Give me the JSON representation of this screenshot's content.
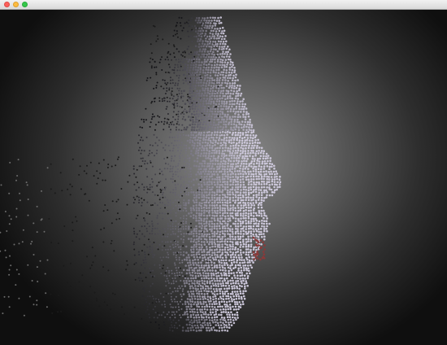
{
  "window": {
    "title": "",
    "controls": {
      "close_icon": "close-icon",
      "minimize_icon": "minimize-icon",
      "maximize_icon": "maximize-icon"
    }
  },
  "colors": {
    "close": "#fc605b",
    "minimize": "#fdbc40",
    "maximize": "#34c84a",
    "background_center": "#8a8a8a",
    "background_edge": "#0f0f0f",
    "skin_light": "#c9c6d2",
    "skin_dark": "#5a4a55",
    "lip_red": "#8a3a3a",
    "sparse_dot": "#1a1a1a"
  }
}
